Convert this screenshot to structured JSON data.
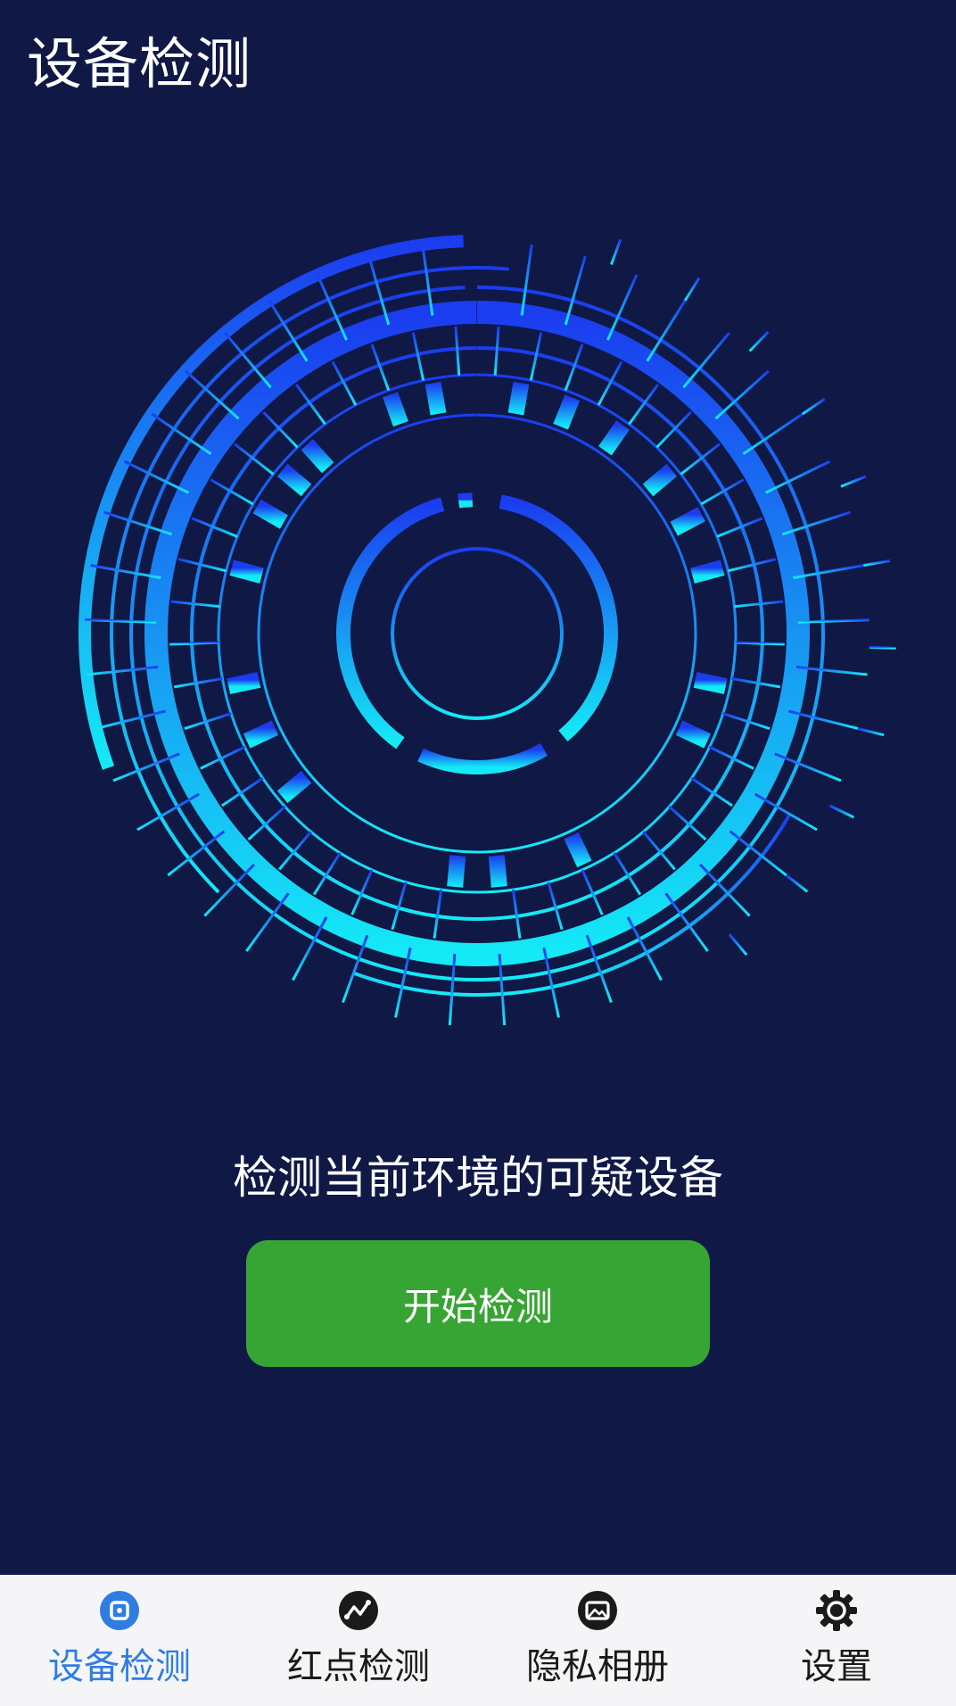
{
  "header": {
    "title": "设备检测"
  },
  "main": {
    "description": "检测当前环境的可疑设备",
    "start_label": "开始检测"
  },
  "tabbar": {
    "tabs": [
      {
        "label": "设备检测",
        "icon": "device-detect-icon",
        "active": true
      },
      {
        "label": "红点检测",
        "icon": "red-dot-detect-icon",
        "active": false
      },
      {
        "label": "隐私相册",
        "icon": "private-album-icon",
        "active": false
      },
      {
        "label": "设置",
        "icon": "gear-icon",
        "active": false
      }
    ]
  },
  "colors": {
    "background": "#101846",
    "scanner_top": "#1b3cf0",
    "scanner_bottom": "#14eaf6",
    "button": "#37a533",
    "active_tab": "#2f7de1",
    "tabbar_bg": "#f5f5f7"
  }
}
